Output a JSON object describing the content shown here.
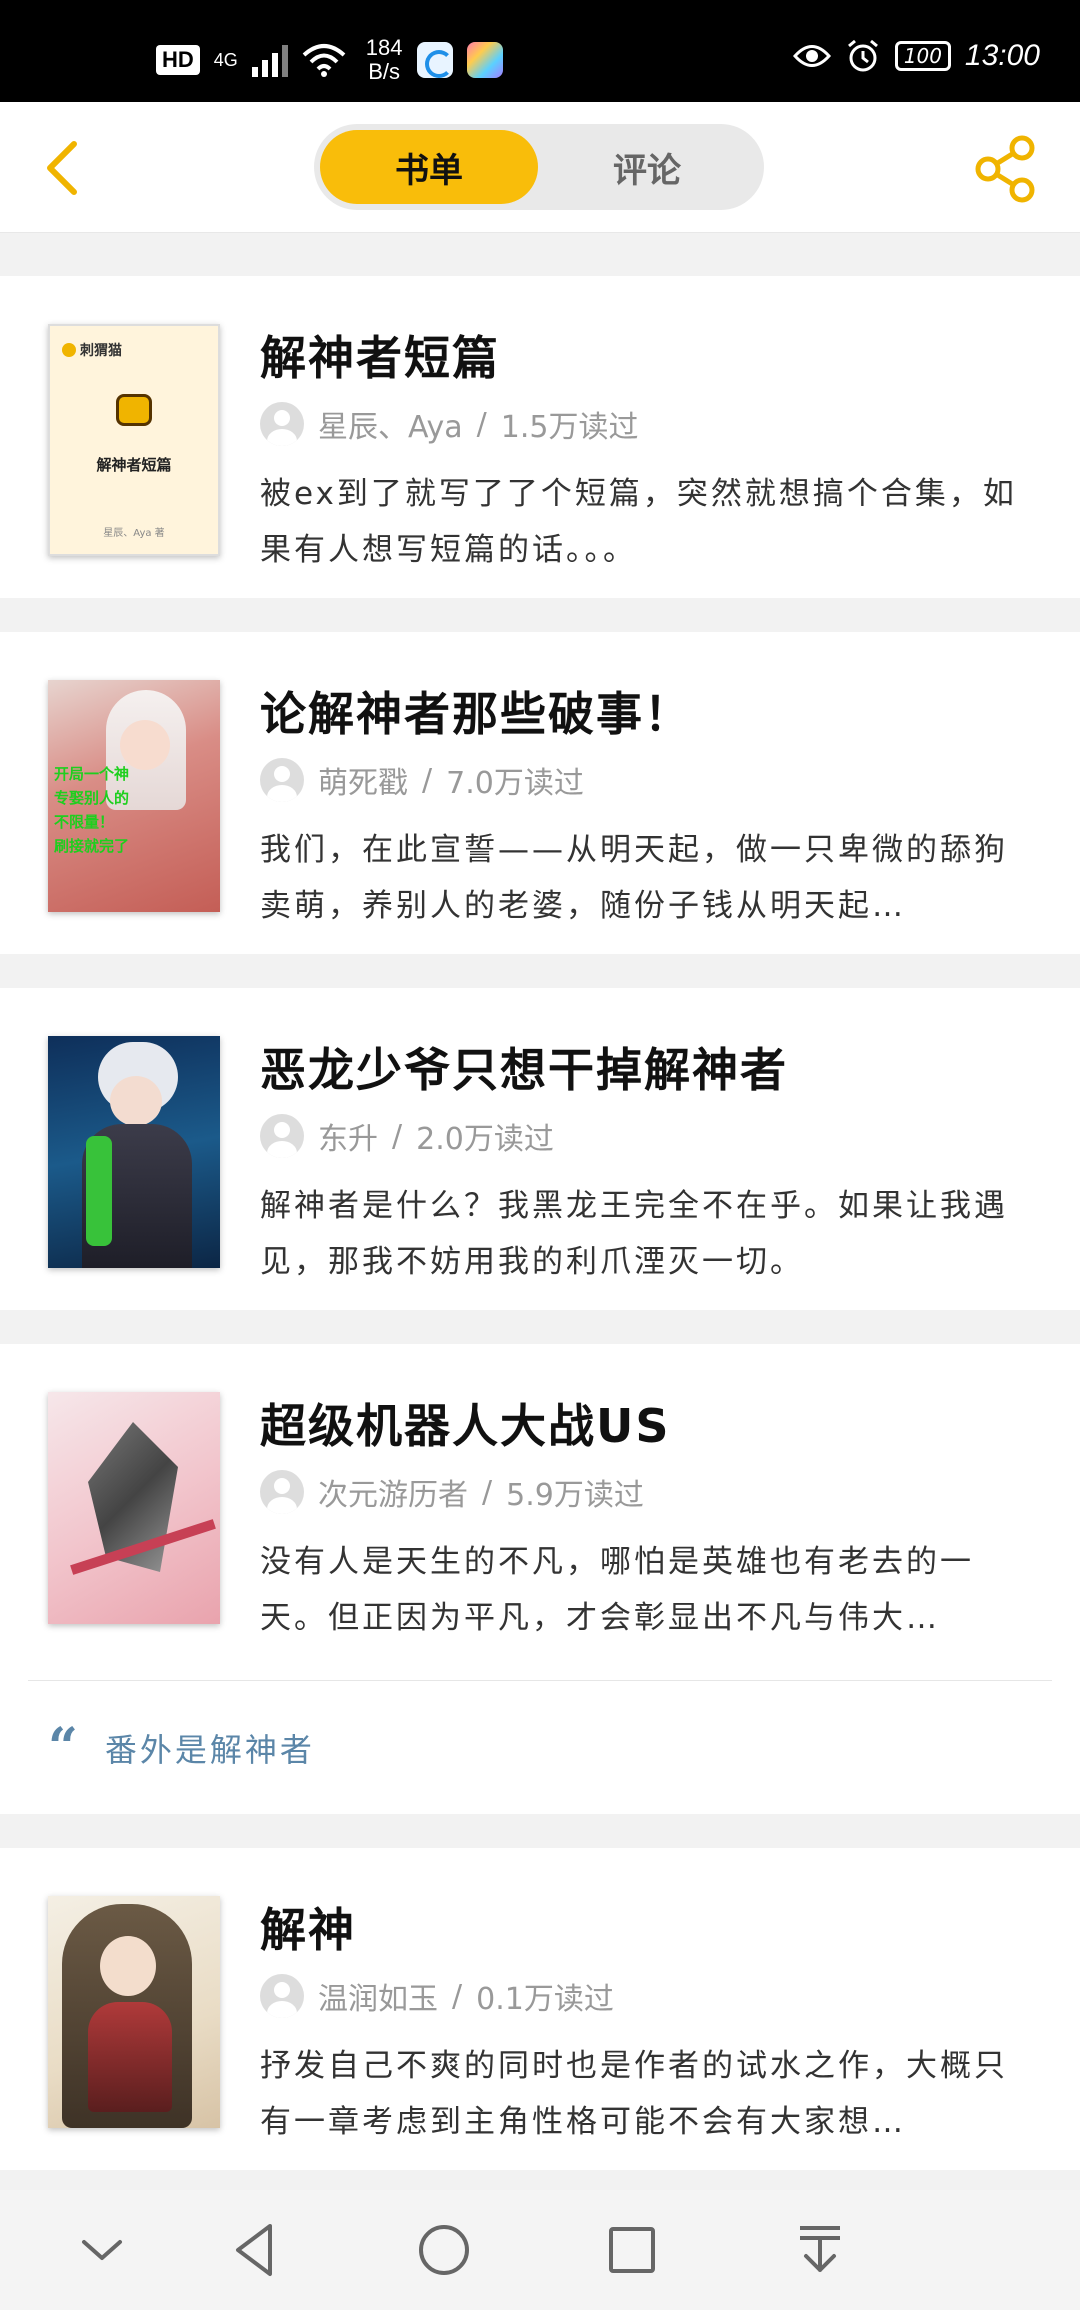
{
  "status_bar": {
    "hd": "HD",
    "network": "4G",
    "speed_value": "184",
    "speed_unit": "B/s",
    "battery": "100",
    "time": "13:00"
  },
  "header": {
    "tabs": [
      {
        "label": "书单",
        "active": true
      },
      {
        "label": "评论",
        "active": false
      }
    ],
    "accent_color": "#f9bd0a"
  },
  "books": [
    {
      "title": "解神者短篇",
      "author": "星辰、Aya",
      "reads": "1.5万读过",
      "description": "被ex到了就写了了个短篇，突然就想搞个合集，如果有人想写短篇的话。。。",
      "cover": {
        "logo": "刺猬猫",
        "title": "解神者短篇",
        "author": "星辰、Aya 著"
      }
    },
    {
      "title": "论解神者那些破事！",
      "author": "萌死戳",
      "reads": "7.0万读过",
      "description": "我们，在此宣誓——从明天起，做一只卑微的舔狗卖萌，养别人的老婆，随份子钱从明天起…",
      "cover": {
        "lines": [
          "开局一个神",
          "专娶别人的",
          "不限量！",
          "刷接就完了"
        ]
      }
    },
    {
      "title": "恶龙少爷只想干掉解神者",
      "author": "东升",
      "reads": "2.0万读过",
      "description": "解神者是什么？我黑龙王完全不在乎。如果让我遇见，那我不妨用我的利爪湮灭一切。"
    },
    {
      "title": "超级机器人大战US",
      "author": "次元游历者",
      "reads": "5.9万读过",
      "description": "没有人是天生的不凡，哪怕是英雄也有老去的一天。但正因为平凡，才会彰显出不凡与伟大…",
      "quote": "番外是解神者"
    },
    {
      "title": "解神",
      "author": "温润如玉",
      "reads": "0.1万读过",
      "description": "抒发自己不爽的同时也是作者的试水之作，大概只有一章考虑到主角性格可能不会有大家想…"
    }
  ],
  "nav": {
    "icons": [
      "chevron-down-icon",
      "back-triangle-icon",
      "home-circle-icon",
      "recents-square-icon",
      "download-icon"
    ]
  }
}
